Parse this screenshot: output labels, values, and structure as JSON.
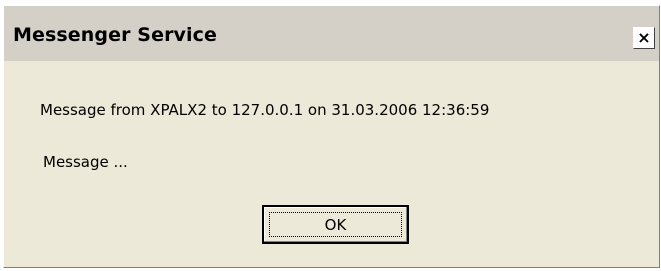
{
  "window": {
    "title": "Messenger Service",
    "close_glyph": "×"
  },
  "message": {
    "header": "Message from XPALX2 to 127.0.0.1 on 31.03.2006 12:36:59",
    "body": "Message ..."
  },
  "buttons": {
    "ok_label": "OK"
  },
  "icons": {
    "close": "close-icon"
  }
}
